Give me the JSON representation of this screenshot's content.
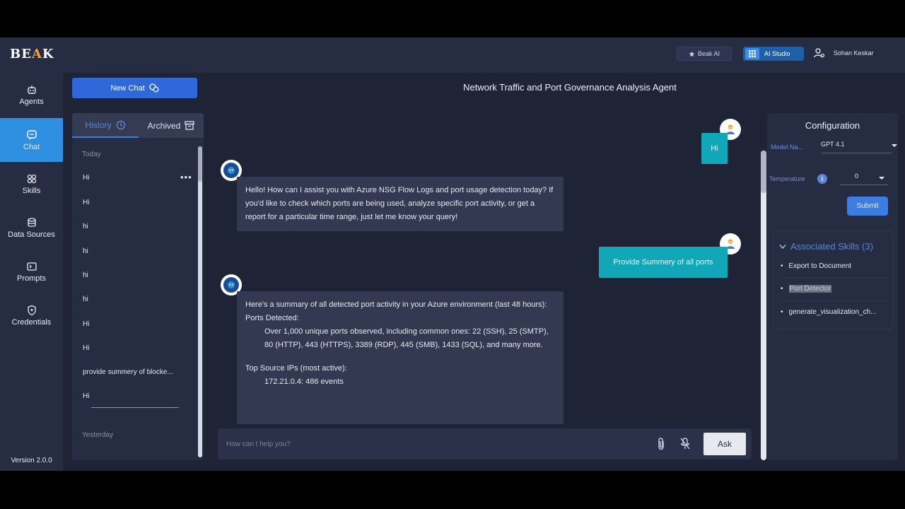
{
  "app": {
    "logo": {
      "part1": "BE",
      "part2": "A",
      "part3": "K"
    },
    "version": "Version 2.0.0"
  },
  "nav": [
    {
      "label": "Agents",
      "icon": "robot-icon"
    },
    {
      "label": "Chat",
      "icon": "chat-icon",
      "active": true
    },
    {
      "label": "Skills",
      "icon": "skills-icon"
    },
    {
      "label": "Data Sources",
      "icon": "database-icon"
    },
    {
      "label": "Prompts",
      "icon": "terminal-icon"
    },
    {
      "label": "Credentials",
      "icon": "shield-icon"
    }
  ],
  "topbar": {
    "beak_ai": "Beak AI",
    "ai_studio": "AI Studio",
    "user_name": "Sohan Keskar"
  },
  "header": {
    "new_chat": "New Chat",
    "agent_title": "Network Traffic and Port Governance Analysis Agent"
  },
  "history": {
    "tab_history": "History",
    "tab_archived": "Archived",
    "group_today": "Today",
    "group_yesterday": "Yesterday",
    "items": [
      "Hi",
      "Hi",
      "hi",
      "hi",
      "hi",
      "hi",
      "Hi",
      "Hi",
      "provide summery of blocke...",
      "Hi"
    ]
  },
  "chat": {
    "user_msg_1": "Hi",
    "bot_msg_1": "Hello! How can I assist you with Azure NSG Flow Logs and port usage detection today? If you'd like to check which ports are being used, analyze specific port activity, or get a report for a particular time range, just let me know your query!",
    "user_msg_2": "Provide Summery of all ports",
    "bot_msg_2": {
      "intro": "Here's a summary of all detected port activity in your Azure environment (last 48 hours):",
      "ports_heading": "Ports Detected:",
      "ports_text": "Over 1,000 unique ports observed, including common ones: 22 (SSH), 25 (SMTP), 80 (HTTP), 443 (HTTPS), 3389 (RDP), 445 (SMB), 1433 (SQL), and many more.",
      "ips_heading": "Top Source IPs (most active):",
      "ip_1": "172.21.0.4: 486 events"
    }
  },
  "input": {
    "placeholder": "How can I help you?",
    "ask": "Ask"
  },
  "config": {
    "title": "Configuration",
    "model_label": "Model Na...",
    "model_value": "GPT 4.1",
    "temperature_label": "Temperature",
    "temperature_value": "0",
    "submit": "Submit",
    "skills_title": "Associated Skills (3)",
    "skills": [
      "Export to Document",
      "Port Detector",
      "generate_visualization_ch..."
    ]
  },
  "colors": {
    "accent": "#2f8fe0",
    "user_bubble": "#11a6b8",
    "logo_accent": "#f2a33a",
    "background": "#1e2335"
  }
}
